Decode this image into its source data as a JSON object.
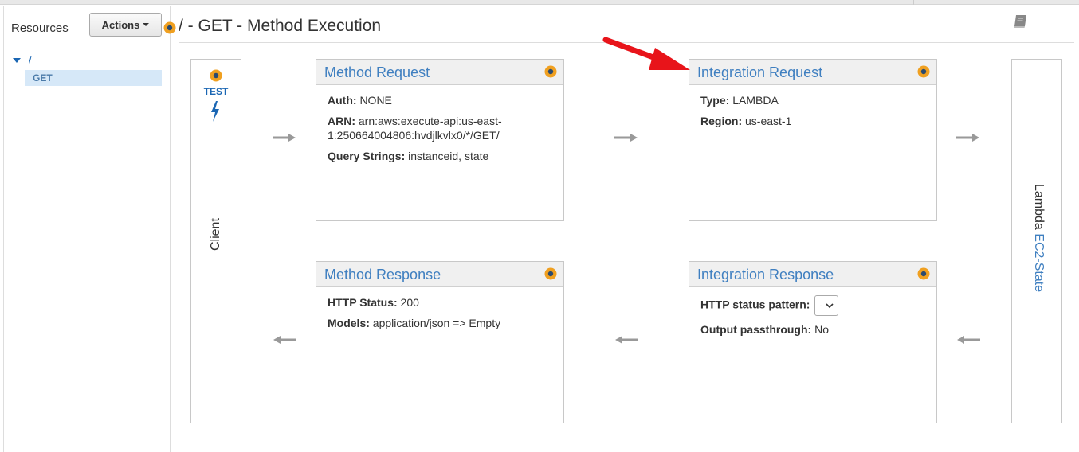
{
  "sidebar": {
    "resources_label": "Resources",
    "actions_label": "Actions",
    "tree": {
      "root": "/",
      "child": "GET"
    }
  },
  "header": {
    "title": "/ - GET - Method Execution"
  },
  "client": {
    "test_label": "TEST",
    "label": "Client"
  },
  "lambda": {
    "prefix": "Lambda ",
    "function": "EC2-State"
  },
  "method_request": {
    "title": "Method Request",
    "auth_label": "Auth:",
    "auth_value": "NONE",
    "arn_label": "ARN:",
    "arn_value_line1": "arn:aws:execute-api:us-east-",
    "arn_value_line2": "1:250664004806:hvdjlkvlx0/*/GET/",
    "query_label": "Query Strings:",
    "query_value": "instanceid, state"
  },
  "integration_request": {
    "title": "Integration Request",
    "type_label": "Type:",
    "type_value": "LAMBDA",
    "region_label": "Region:",
    "region_value": "us-east-1"
  },
  "method_response": {
    "title": "Method Response",
    "status_label": "HTTP Status:",
    "status_value": "200",
    "models_label": "Models:",
    "models_value": "application/json => Empty"
  },
  "integration_response": {
    "title": "Integration Response",
    "pattern_label": "HTTP status pattern:",
    "pattern_value": "-",
    "passthrough_label": "Output passthrough:",
    "passthrough_value": "No"
  },
  "colors": {
    "accent_blue": "#3f7fc0",
    "highlight": "#d6e8f8",
    "annotation_red": "#e8141a",
    "status_orange": "#f0a020"
  },
  "icons": [
    "settings-dot-icon",
    "book-icon",
    "lightning-bolt-icon",
    "arrow-right-icon",
    "arrow-left-icon",
    "caret-down-icon"
  ]
}
